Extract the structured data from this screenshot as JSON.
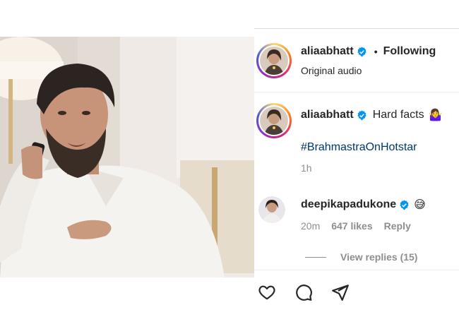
{
  "post": {
    "author": "aliaabhatt",
    "following_label": "Following",
    "separator": "•",
    "audio": "Original audio"
  },
  "caption": {
    "author": "aliaabhatt",
    "text": "Hard facts",
    "emoji": "🤷‍♀️",
    "hashtag": "#BrahmastraOnHotstar",
    "time": "1h"
  },
  "comment": {
    "author": "deepikapadukone",
    "emoji": "😅",
    "time": "20m",
    "likes": "647 likes",
    "reply_label": "Reply",
    "view_replies": "View replies (15)"
  },
  "icons": {
    "verified": "verified-badge-icon",
    "like": "heart-icon",
    "comment": "comment-bubble-icon",
    "share": "paper-plane-icon"
  },
  "colors": {
    "verified_blue": "#0095f6",
    "hashtag": "#00376b",
    "muted": "#8e8e8e",
    "text": "#262626"
  }
}
